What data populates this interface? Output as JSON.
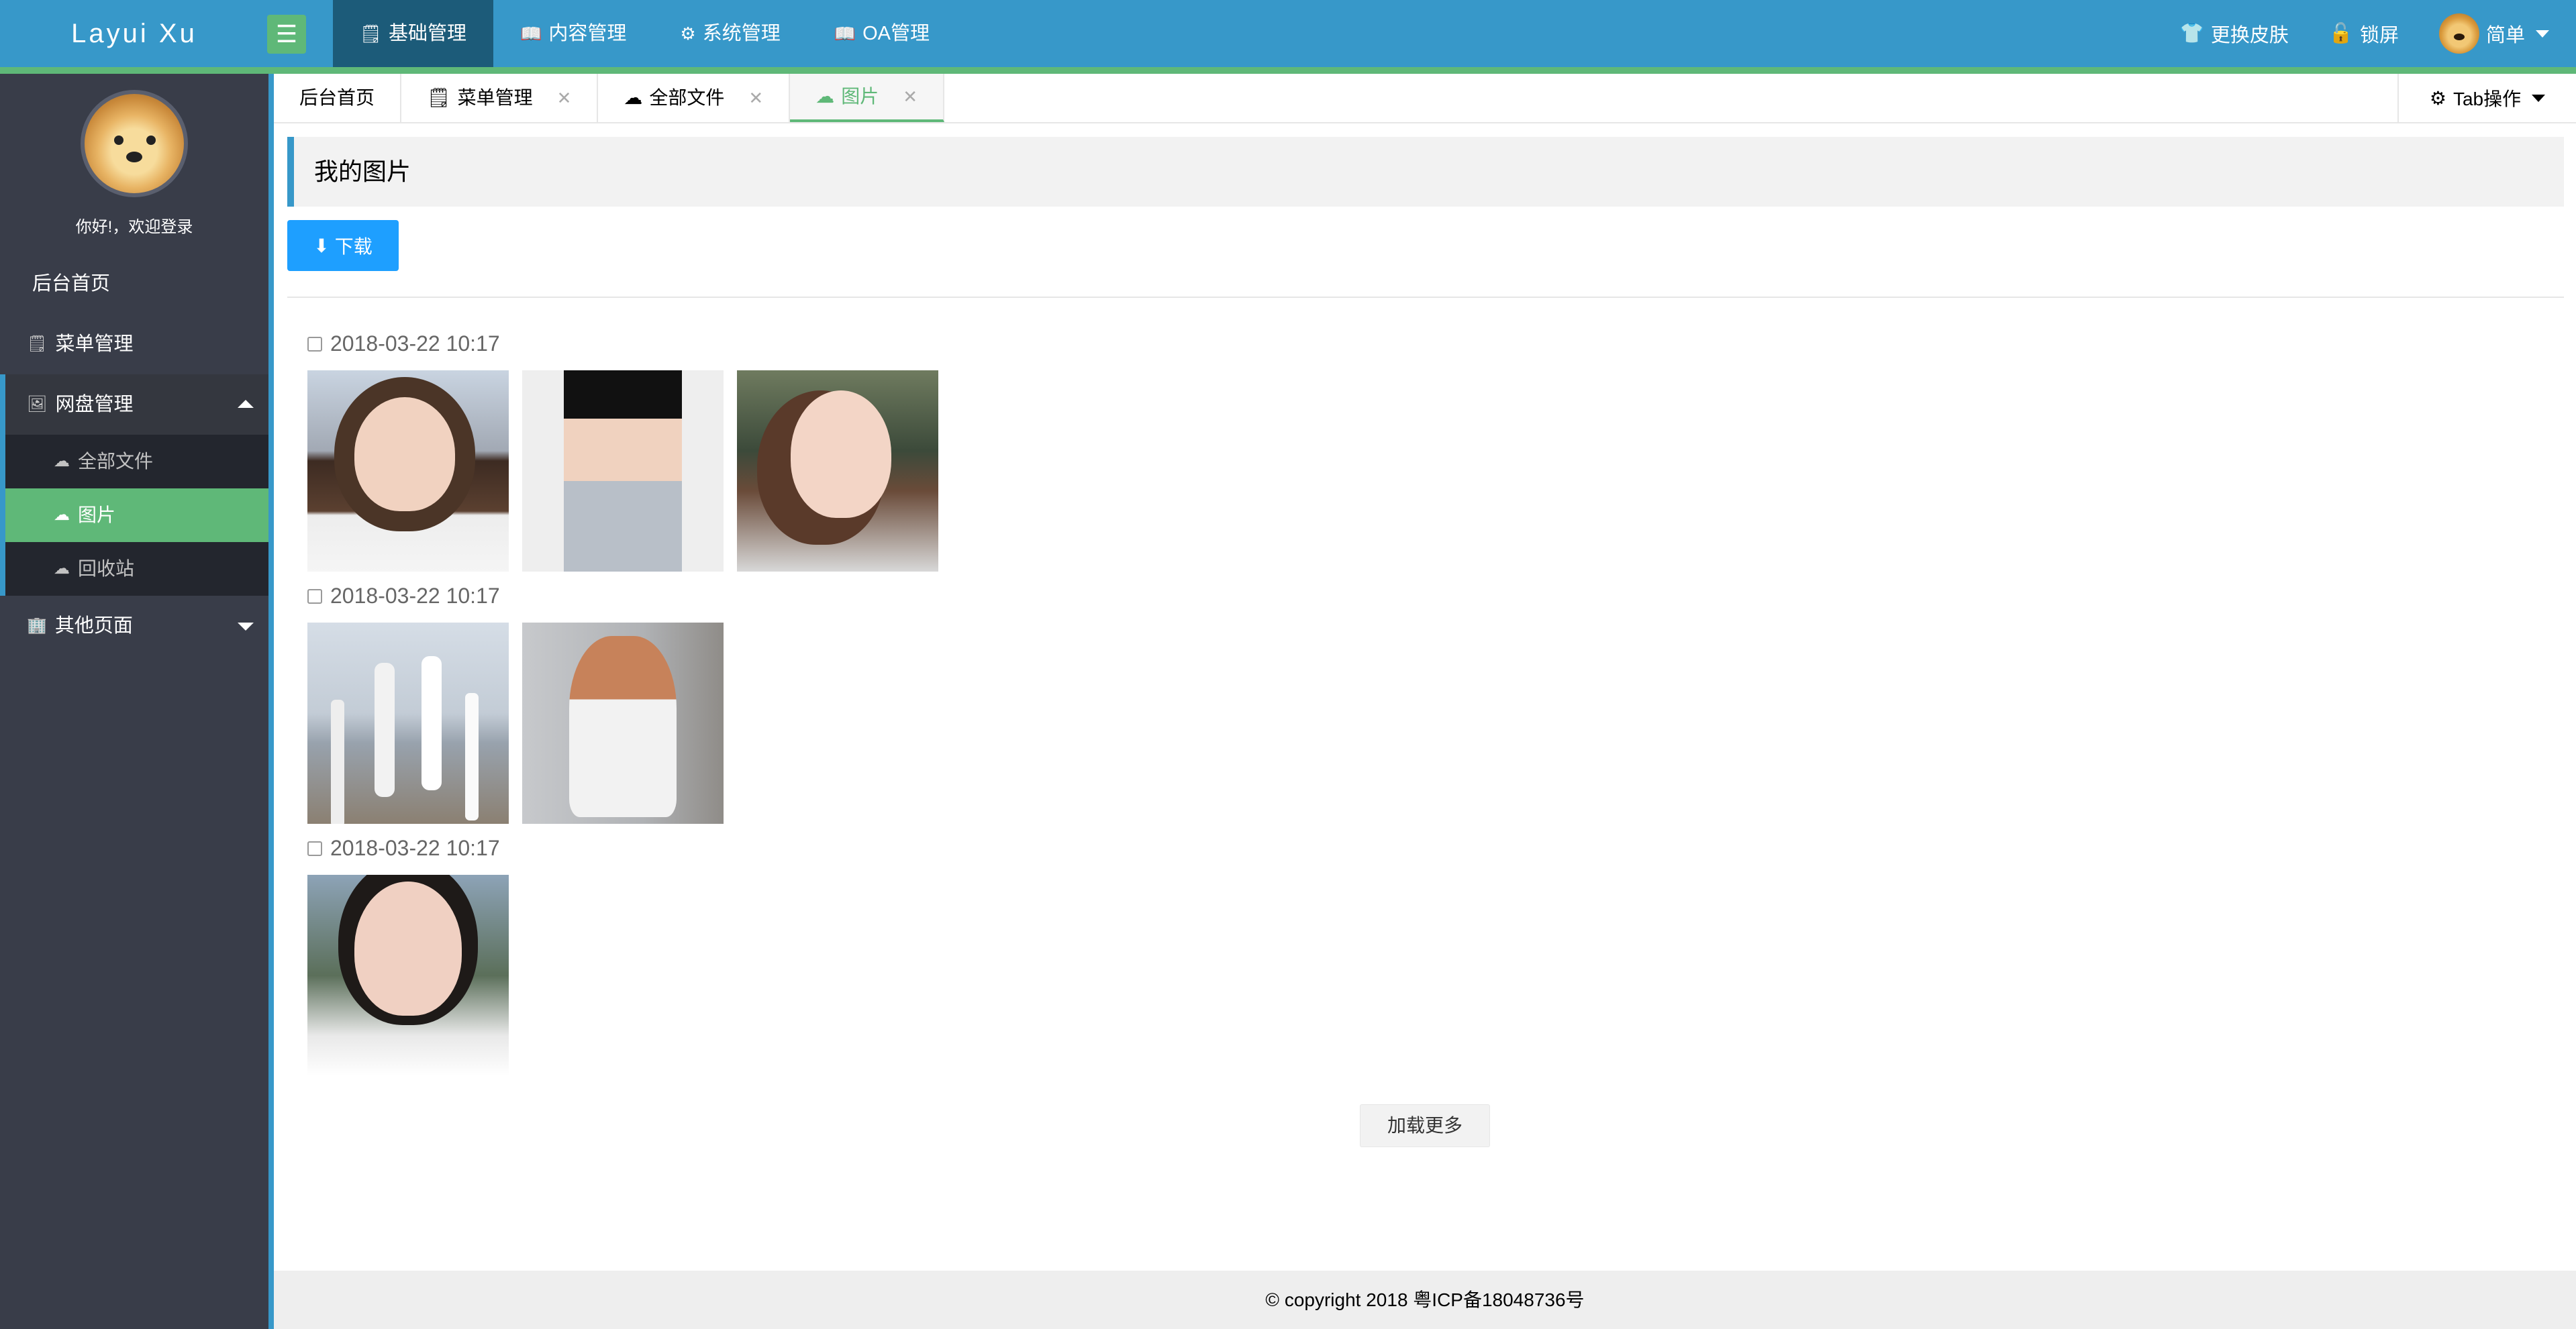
{
  "header": {
    "logo": "Layui Xu",
    "menu_toggle_icon": "hamburger-icon",
    "nav": [
      {
        "label": "基础管理",
        "icon": "doc-icon",
        "active": true
      },
      {
        "label": "内容管理",
        "icon": "book-icon",
        "active": false
      },
      {
        "label": "系统管理",
        "icon": "gear-icon",
        "active": false
      },
      {
        "label": "OA管理",
        "icon": "book-icon",
        "active": false
      }
    ],
    "right": {
      "skin_label": "更换皮肤",
      "lock_label": "锁屏",
      "user_label": "简单"
    }
  },
  "sidebar": {
    "welcome": "你好!，欢迎登录",
    "items": [
      {
        "label": "后台首页"
      },
      {
        "label": "菜单管理",
        "icon": "doc-icon"
      },
      {
        "label": "网盘管理",
        "icon": "image-icon",
        "expanded": true,
        "children": [
          {
            "label": "全部文件",
            "icon": "cloud-icon"
          },
          {
            "label": "图片",
            "icon": "cloud-icon",
            "active": true
          },
          {
            "label": "回收站",
            "icon": "cloud-icon"
          }
        ]
      },
      {
        "label": "其他页面",
        "icon": "building-icon",
        "expanded": false
      }
    ]
  },
  "tabs": {
    "items": [
      {
        "label": "后台首页",
        "closable": false
      },
      {
        "label": "菜单管理",
        "closable": true
      },
      {
        "label": "全部文件",
        "closable": true
      },
      {
        "label": "图片",
        "closable": true,
        "active": true
      }
    ],
    "ops_label": "Tab操作"
  },
  "main": {
    "title": "我的图片",
    "download_label": "下载",
    "groups": [
      {
        "date": "2018-03-22 10:17",
        "photos": 3
      },
      {
        "date": "2018-03-22 10:17",
        "photos": 2
      },
      {
        "date": "2018-03-22 10:17",
        "photos": 1
      }
    ],
    "load_more_label": "加载更多"
  },
  "footer": {
    "text": "© copyright 2018 粤ICP备18048736号"
  },
  "colors": {
    "header": "#3798c9",
    "accent_green": "#5fb878",
    "sidebar_bg": "#393d49",
    "active_nav": "#1c5b79",
    "button_blue": "#1e9fff"
  }
}
